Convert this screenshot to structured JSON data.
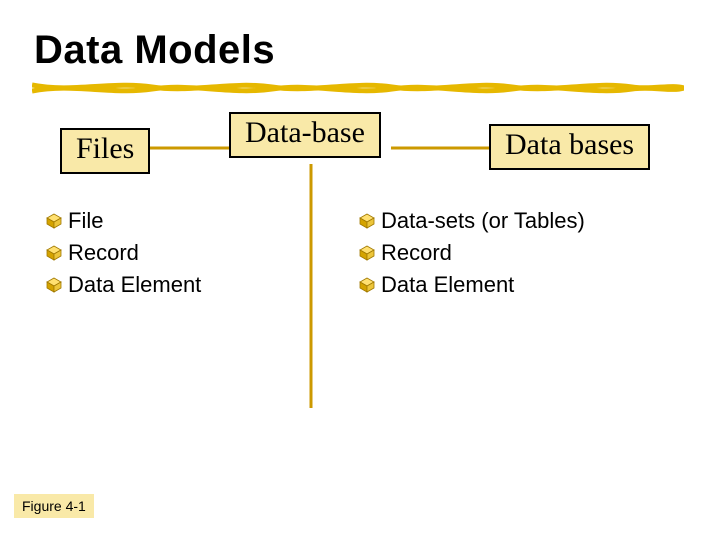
{
  "title": "Data Models",
  "boxes": {
    "files": "Files",
    "database_top": "Data-base",
    "databases": "Data bases"
  },
  "left_bullets": [
    "File",
    "Record",
    "Data Element"
  ],
  "right_bullets": [
    "Data-sets (or Tables)",
    "Record",
    "Data Element"
  ],
  "figure_label": "Figure 4-1"
}
